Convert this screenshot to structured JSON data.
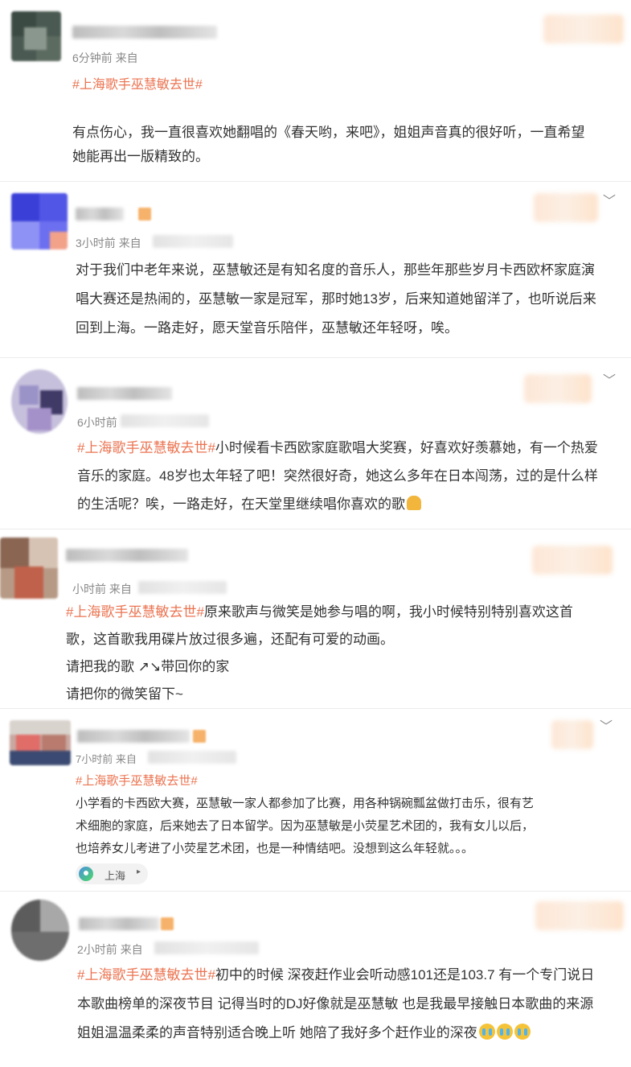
{
  "comments": [
    {
      "time": "6分钟前",
      "source_prefix": "来自",
      "hashtag": "#上海歌手巫慧敏去世#",
      "lines": [
        "有点伤心，我一直很喜欢她翻唱的《春天哟，来吧》，姐姐声音真的很好听，一直希望",
        "她能再出一版精致的。"
      ]
    },
    {
      "time": "3小时前",
      "source_prefix": "来自",
      "lines": [
        "对于我们中老年来说，巫慧敏还是有知名度的音乐人，那些年那些岁月卡西欧杯家庭演",
        "唱大赛还是热闹的，巫慧敏一家是冠军，那时她13岁，后来知道她留洋了，也听说后来",
        "回到上海。一路走好，愿天堂音乐陪伴，巫慧敏还年轻呀，唉。"
      ]
    },
    {
      "time": "6小时前",
      "hashtag": "#上海歌手巫慧敏去世#",
      "lines": [
        "小时候看卡西欧家庭歌唱大奖赛，好喜欢好羡慕她，有一个热爱",
        "音乐的家庭。48岁也太年轻了吧！突然很好奇，她这么多年在日本闯荡，过的是什么样",
        "的生活呢？唉，一路走好，在天堂里继续唱你喜欢的歌"
      ],
      "emoji": "folded-hands-emoji"
    },
    {
      "time": "小时前",
      "source_prefix": "来自",
      "hashtag": "#上海歌手巫慧敏去世#",
      "lines": [
        "原来歌声与微笑是她参与唱的啊，我小时候特别特别喜欢这首",
        "歌，这首歌我用碟片放过很多遍，还配有可爱的动画。",
        "请把我的歌 ↗↘带回你的家",
        "请把你的微笑留下~"
      ]
    },
    {
      "time": "7小时前",
      "source_prefix": "来自",
      "hashtag": "#上海歌手巫慧敏去世#",
      "lines": [
        "小学看的卡西欧大赛，巫慧敏一家人都参加了比赛，用各种锅碗瓢盆做打击乐，很有艺",
        "术细胞的家庭，后来她去了日本留学。因为巫慧敏是小荧星艺术团的，我有女儿以后，",
        "也培养女儿考进了小荧星艺术团，也是一种情结吧。没想到这么年轻就。。。"
      ],
      "location": "上海",
      "location_arrow": "▸"
    },
    {
      "time": "2小时前",
      "source_prefix": "来自",
      "hashtag": "#上海歌手巫慧敏去世#",
      "lines": [
        "初中的时候 深夜赶作业会听动感101还是103.7 有一个专门说日",
        "本歌曲榜单的深夜节目 记得当时的DJ好像就是巫慧敏 也是我最早接触日本歌曲的来源",
        "姐姐温温柔柔的声音特别适合晚上听 她陪了我好多个赶作业的深夜"
      ],
      "emoji": "loudly-crying-face-emoji"
    }
  ],
  "chevron": "﹀"
}
